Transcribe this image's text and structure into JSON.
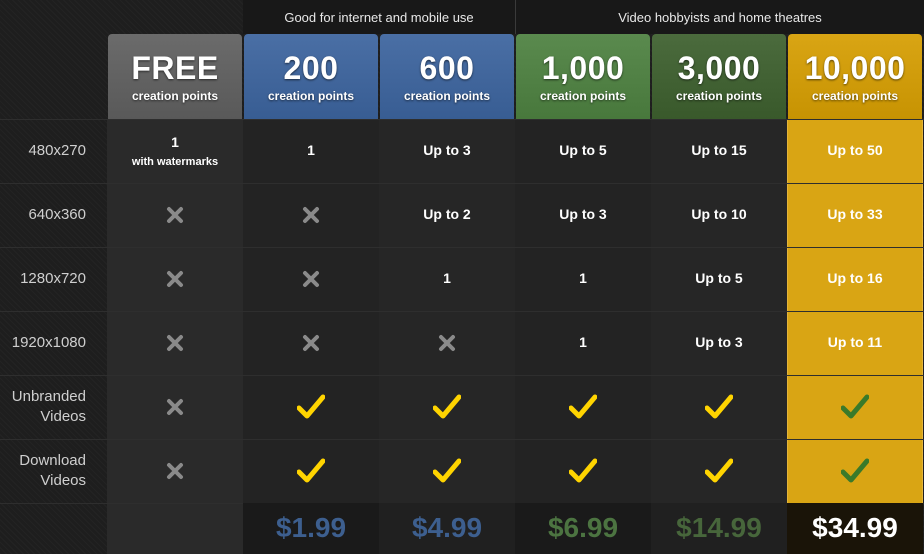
{
  "groups": [
    {
      "label": "Good for internet and mobile use"
    },
    {
      "label": "Video hobbyists and home theatres"
    }
  ],
  "plans": [
    {
      "points": "FREE",
      "subtitle": "creation points",
      "color": "#6b6b6b",
      "price": ""
    },
    {
      "points": "200",
      "subtitle": "creation points",
      "color": "#4a6fa5",
      "price": "$1.99",
      "price_color": "#3d5f8f"
    },
    {
      "points": "600",
      "subtitle": "creation points",
      "color": "#4a6fa5",
      "price": "$4.99",
      "price_color": "#3d5f8f"
    },
    {
      "points": "1,000",
      "subtitle": "creation points",
      "color": "#5a8a4e",
      "price": "$6.99",
      "price_color": "#4c7441"
    },
    {
      "points": "3,000",
      "subtitle": "creation points",
      "color": "#4b6b3d",
      "price": "$14.99",
      "price_color": "#47663b"
    },
    {
      "points": "10,000",
      "subtitle": "creation points",
      "color": "#d9a514",
      "price": "$34.99",
      "price_color": "#ffffff"
    }
  ],
  "rows": [
    {
      "label": "480x270",
      "cells": [
        {
          "type": "text",
          "text": "1",
          "note": "with watermarks"
        },
        {
          "type": "text",
          "text": "1"
        },
        {
          "type": "text",
          "text": "Up to 3"
        },
        {
          "type": "text",
          "text": "Up to 5"
        },
        {
          "type": "text",
          "text": "Up to 15"
        },
        {
          "type": "text",
          "text": "Up to 50"
        }
      ]
    },
    {
      "label": "640x360",
      "cells": [
        {
          "type": "cross"
        },
        {
          "type": "cross"
        },
        {
          "type": "text",
          "text": "Up to 2"
        },
        {
          "type": "text",
          "text": "Up to 3"
        },
        {
          "type": "text",
          "text": "Up to 10"
        },
        {
          "type": "text",
          "text": "Up to 33"
        }
      ]
    },
    {
      "label": "1280x720",
      "cells": [
        {
          "type": "cross"
        },
        {
          "type": "cross"
        },
        {
          "type": "text",
          "text": "1"
        },
        {
          "type": "text",
          "text": "1"
        },
        {
          "type": "text",
          "text": "Up to 5"
        },
        {
          "type": "text",
          "text": "Up to 16"
        }
      ]
    },
    {
      "label": "1920x1080",
      "cells": [
        {
          "type": "cross"
        },
        {
          "type": "cross"
        },
        {
          "type": "cross"
        },
        {
          "type": "text",
          "text": "1"
        },
        {
          "type": "text",
          "text": "Up to 3"
        },
        {
          "type": "text",
          "text": "Up to 11"
        }
      ]
    },
    {
      "label": "Unbranded Videos",
      "cells": [
        {
          "type": "cross"
        },
        {
          "type": "check"
        },
        {
          "type": "check"
        },
        {
          "type": "check"
        },
        {
          "type": "check"
        },
        {
          "type": "check-green"
        }
      ]
    },
    {
      "label": "Download Videos",
      "cells": [
        {
          "type": "cross"
        },
        {
          "type": "check"
        },
        {
          "type": "check"
        },
        {
          "type": "check"
        },
        {
          "type": "check"
        },
        {
          "type": "check-green"
        }
      ]
    }
  ],
  "icons": {
    "cross": "cross-icon",
    "check": "checkmark-icon",
    "check_green": "checkmark-icon"
  },
  "colors": {
    "check_yellow": "#ffd400",
    "check_green": "#3a7a2a",
    "cross": "#8a8a8a",
    "gold": "#d9a514"
  }
}
